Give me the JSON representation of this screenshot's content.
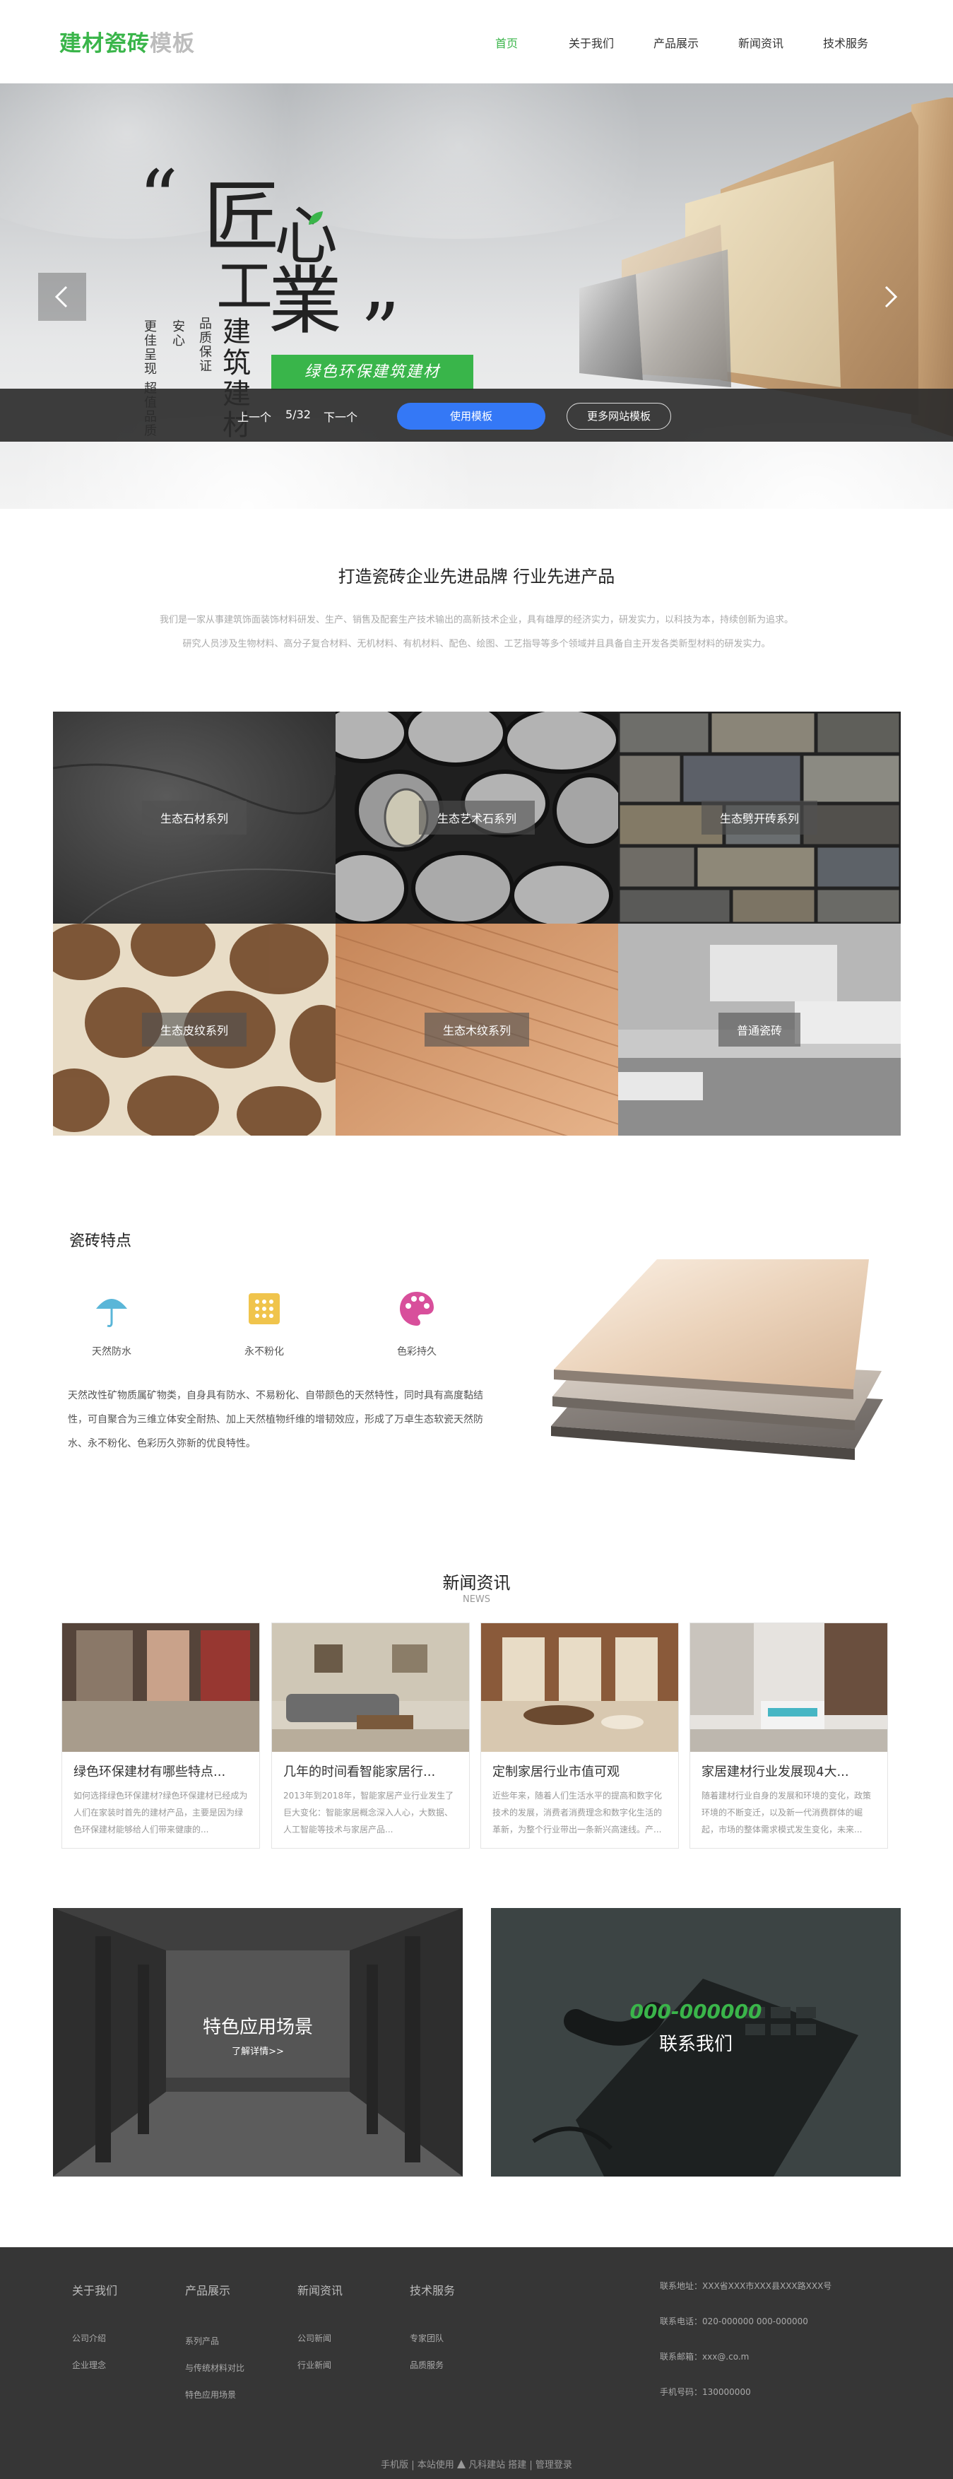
{
  "header": {
    "logo_green": "建材瓷砖",
    "logo_gray": "模板",
    "nav": [
      "首页",
      "关于我们",
      "产品展示",
      "新闻资讯",
      "技术服务"
    ]
  },
  "banner": {
    "quote_open": "“",
    "quote_close": "”",
    "char_jiang": "匠",
    "char_xin": "心",
    "char_gong": "工",
    "char_ye": "業",
    "vertical_big": "建筑建材",
    "vertical_1": "品质保证",
    "vertical_2": "安心",
    "vertical_3": "更佳呈现 超值品质",
    "tag": "绿色环保建筑建材",
    "prev": "上一个",
    "counter": "5/32",
    "next": "下一个",
    "use_button": "使用模板",
    "more_button": "更多网站模板"
  },
  "intro": {
    "title": "打造瓷砖企业先进品牌 行业先进产品",
    "line1": "我们是一家从事建筑饰面装饰材料研发、生产、销售及配套生产技术输出的高新技术企业，具有雄厚的经济实力，研发实力，以科技为本，持续创新为追求。",
    "line2": "研究人员涉及生物材料、高分子复合材料、无机材料、有机材料、配色、绘图、工艺指导等多个领域并且具备自主开发各类新型材料的研发实力。"
  },
  "products": [
    {
      "label": "生态石材系列"
    },
    {
      "label": "生态艺术石系列"
    },
    {
      "label": "生态劈开砖系列"
    },
    {
      "label": "生态皮纹系列"
    },
    {
      "label": "生态木纹系列"
    },
    {
      "label": "普通瓷砖"
    }
  ],
  "features": {
    "title": "瓷砖特点",
    "items": [
      {
        "label": "天然防水",
        "icon": "umbrella-icon"
      },
      {
        "label": "永不粉化",
        "icon": "dots-grid-icon"
      },
      {
        "label": "色彩持久",
        "icon": "palette-icon"
      }
    ],
    "text": "天然改性矿物质属矿物类，自身具有防水、不易粉化、自带颜色的天然特性，同时具有高度黏结性，可自聚合为三维立体安全耐热、加上天然植物纤维的增韧效应，形成了万卓生态软瓷天然防水、永不粉化、色彩历久弥新的优良特性。"
  },
  "news": {
    "title": "新闻资讯",
    "subtitle": "NEWS",
    "items": [
      {
        "title": "绿色环保建材有哪些特点...",
        "desc": "如何选择绿色环保建材?绿色环保建材已经成为人们在家装时首先的建材产品，主要是因为绿色环保建材能够给人们带来健康的..."
      },
      {
        "title": "几年的时间看智能家居行...",
        "desc": "2013年到2018年，智能家居产业行业发生了巨大变化：智能家居概念深入人心，大数据、人工智能等技术与家居产品..."
      },
      {
        "title": "定制家居行业市值可观",
        "desc": "近些年来，随着人们生活水平的提高和数字化技术的发展，消费者消费理念和数字化生活的革新，为整个行业带出一条新兴高速线。产..."
      },
      {
        "title": "家居建材行业发展现4大...",
        "desc": "随着建材行业自身的发展和环境的变化，政策环境的不断变迁，以及新一代消费群体的崛起，市场的整体需求模式发生变化，未来..."
      }
    ]
  },
  "promo": {
    "scene_title": "特色应用场景",
    "scene_link": "了解详情>>",
    "phone": "000-000000",
    "contact_title": "联系我们"
  },
  "footer": {
    "columns": [
      {
        "title": "关于我们",
        "links": [
          "公司介绍",
          "企业理念"
        ]
      },
      {
        "title": "产品展示",
        "links": [
          "系列产品",
          "与传统材料对比",
          "特色应用场景"
        ]
      },
      {
        "title": "新闻资讯",
        "links": [
          "公司新闻",
          "行业新闻"
        ]
      },
      {
        "title": "技术服务",
        "links": [
          "专家团队",
          "品质服务"
        ]
      }
    ],
    "info": [
      "联系地址：XXX省XXX市XXX县XXX路XXX号",
      "联系电话：020-000000 000-000000",
      "联系邮箱：xxx@.co.m",
      "手机号码：130000000"
    ],
    "bottom": {
      "mobile": "手机版",
      "site_use": "本站使用",
      "fanke": "凡科建站",
      "build": "搭建",
      "login": "管理登录"
    }
  }
}
